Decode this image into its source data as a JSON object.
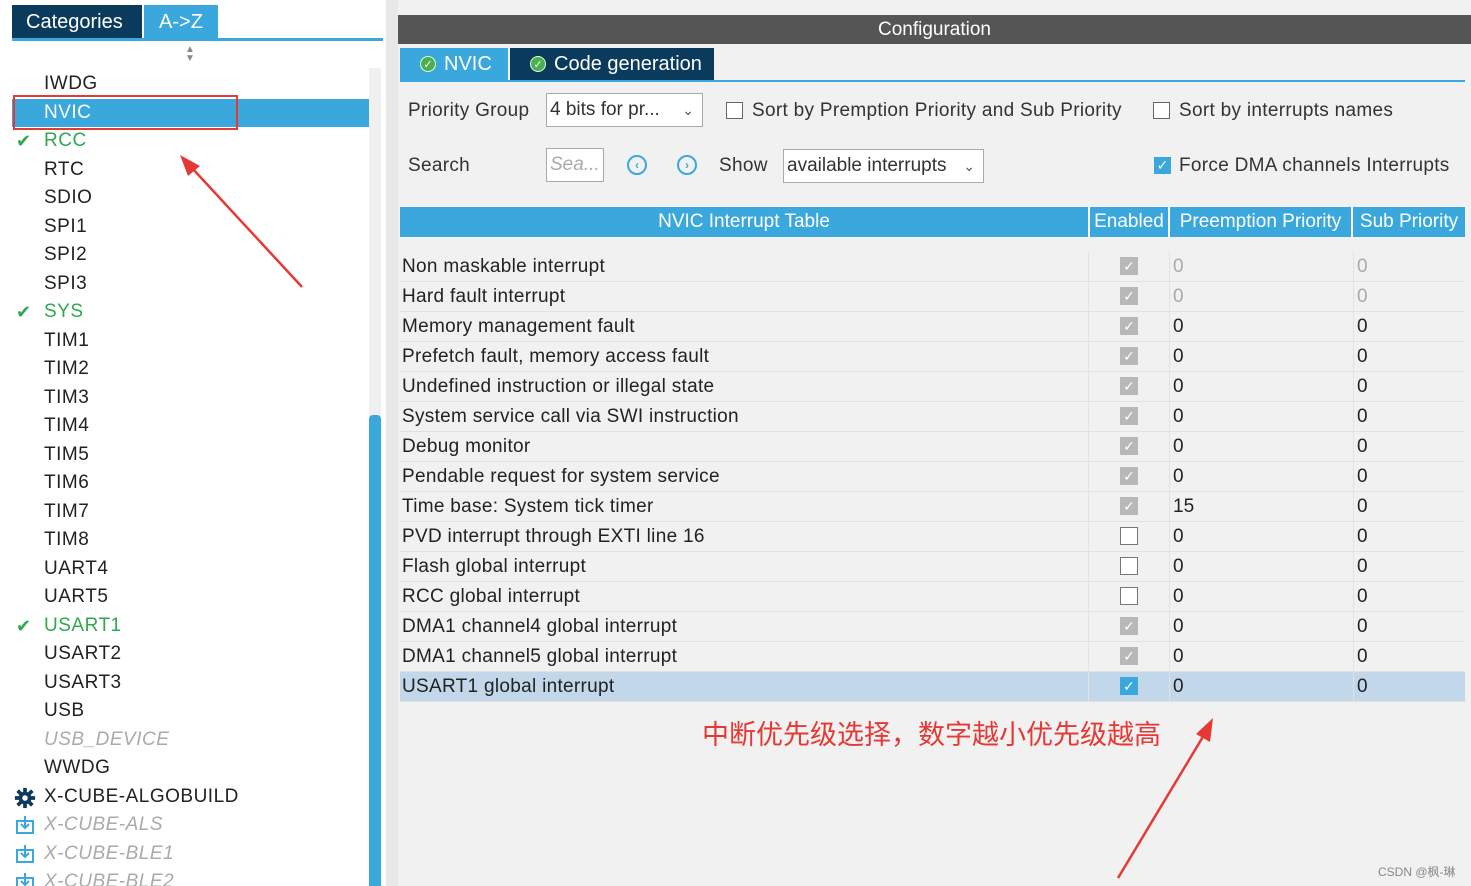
{
  "left_panel": {
    "tabs": [
      {
        "label": "Categories"
      },
      {
        "label": "A->Z"
      }
    ],
    "items": [
      {
        "label": "IWDG",
        "state": "normal"
      },
      {
        "label": "NVIC",
        "state": "selected"
      },
      {
        "label": "RCC",
        "state": "configured"
      },
      {
        "label": "RTC",
        "state": "normal"
      },
      {
        "label": "SDIO",
        "state": "normal"
      },
      {
        "label": "SPI1",
        "state": "normal"
      },
      {
        "label": "SPI2",
        "state": "normal"
      },
      {
        "label": "SPI3",
        "state": "normal"
      },
      {
        "label": "SYS",
        "state": "configured"
      },
      {
        "label": "TIM1",
        "state": "normal"
      },
      {
        "label": "TIM2",
        "state": "normal"
      },
      {
        "label": "TIM3",
        "state": "normal"
      },
      {
        "label": "TIM4",
        "state": "normal"
      },
      {
        "label": "TIM5",
        "state": "normal"
      },
      {
        "label": "TIM6",
        "state": "normal"
      },
      {
        "label": "TIM7",
        "state": "normal"
      },
      {
        "label": "TIM8",
        "state": "normal"
      },
      {
        "label": "UART4",
        "state": "normal"
      },
      {
        "label": "UART5",
        "state": "normal"
      },
      {
        "label": "USART1",
        "state": "configured"
      },
      {
        "label": "USART2",
        "state": "normal"
      },
      {
        "label": "USART3",
        "state": "normal"
      },
      {
        "label": "USB",
        "state": "normal"
      },
      {
        "label": "USB_DEVICE",
        "state": "disabled"
      },
      {
        "label": "WWDG",
        "state": "normal"
      },
      {
        "label": "X-CUBE-ALGOBUILD",
        "state": "pack"
      },
      {
        "label": "X-CUBE-ALS",
        "state": "download"
      },
      {
        "label": "X-CUBE-BLE1",
        "state": "download"
      },
      {
        "label": "X-CUBE-BLE2",
        "state": "download"
      }
    ],
    "icons": {
      "check": "check-icon",
      "gear": "gear-icon",
      "download": "download-icon"
    }
  },
  "config": {
    "title": "Configuration",
    "tabs": [
      {
        "label": "NVIC"
      },
      {
        "label": "Code generation"
      }
    ],
    "priority_group_label": "Priority Group",
    "priority_group_value": "4 bits for pr...",
    "sort_premption_label": "Sort by Premption Priority and Sub Priority",
    "sort_premption_checked": false,
    "sort_names_label": "Sort by interrupts names",
    "sort_names_checked": false,
    "search_label": "Search",
    "search_placeholder": "Sea...",
    "show_label": "Show",
    "show_value": "available interrupts",
    "force_dma_label": "Force DMA channels Interrupts",
    "force_dma_checked": true
  },
  "table": {
    "headers": [
      "NVIC Interrupt Table",
      "Enabled",
      "Preemption Priority",
      "Sub Priority"
    ],
    "rows": [
      {
        "name": "Non maskable interrupt",
        "enabled": true,
        "locked": true,
        "preemption": "0",
        "sub": "0",
        "dim": true
      },
      {
        "name": "Hard fault interrupt",
        "enabled": true,
        "locked": true,
        "preemption": "0",
        "sub": "0",
        "dim": true
      },
      {
        "name": "Memory management fault",
        "enabled": true,
        "locked": true,
        "preemption": "0",
        "sub": "0",
        "dim": false
      },
      {
        "name": "Prefetch fault, memory access fault",
        "enabled": true,
        "locked": true,
        "preemption": "0",
        "sub": "0",
        "dim": false
      },
      {
        "name": "Undefined instruction or illegal state",
        "enabled": true,
        "locked": true,
        "preemption": "0",
        "sub": "0",
        "dim": false
      },
      {
        "name": "System service call via SWI instruction",
        "enabled": true,
        "locked": true,
        "preemption": "0",
        "sub": "0",
        "dim": false
      },
      {
        "name": "Debug monitor",
        "enabled": true,
        "locked": true,
        "preemption": "0",
        "sub": "0",
        "dim": false
      },
      {
        "name": "Pendable request for system service",
        "enabled": true,
        "locked": true,
        "preemption": "0",
        "sub": "0",
        "dim": false
      },
      {
        "name": "Time base: System tick timer",
        "enabled": true,
        "locked": true,
        "preemption": "15",
        "sub": "0",
        "dim": false
      },
      {
        "name": "PVD interrupt through EXTI line 16",
        "enabled": false,
        "locked": false,
        "preemption": "0",
        "sub": "0",
        "dim": false
      },
      {
        "name": "Flash global interrupt",
        "enabled": false,
        "locked": false,
        "preemption": "0",
        "sub": "0",
        "dim": false
      },
      {
        "name": "RCC global interrupt",
        "enabled": false,
        "locked": false,
        "preemption": "0",
        "sub": "0",
        "dim": false
      },
      {
        "name": "DMA1 channel4 global interrupt",
        "enabled": true,
        "locked": true,
        "preemption": "0",
        "sub": "0",
        "dim": false
      },
      {
        "name": "DMA1 channel5 global interrupt",
        "enabled": true,
        "locked": true,
        "preemption": "0",
        "sub": "0",
        "dim": false
      },
      {
        "name": "USART1 global interrupt",
        "enabled": true,
        "locked": false,
        "preemption": "0",
        "sub": "0",
        "dim": false,
        "selected": true
      }
    ]
  },
  "annotation": {
    "text": "中断优先级选择，数字越小优先级越高",
    "color": "#e53935"
  },
  "watermark": "CSDN @枫-琳",
  "colors": {
    "accent": "#3aa8dd",
    "dark_tab": "#0a3a5c",
    "header_gray": "#555555",
    "configured_green": "#2fa84f",
    "highlight_red": "#e53935",
    "selected_row": "#c3d7ea"
  }
}
